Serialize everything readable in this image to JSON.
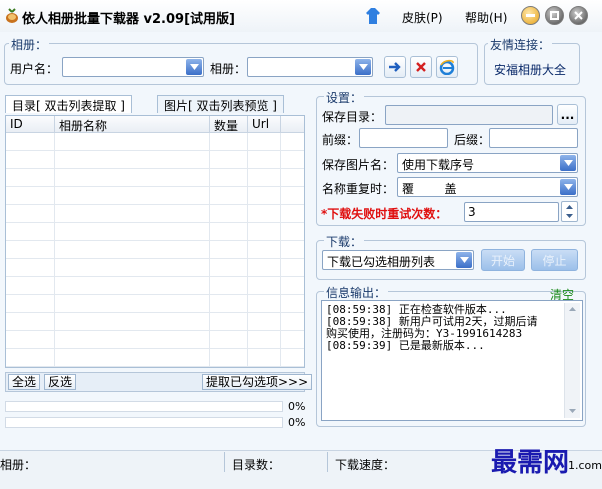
{
  "window": {
    "title": "依人相册批量下载器 v2.09[试用版]",
    "skin_label": "皮肤(P)",
    "help_label": "帮助(H)"
  },
  "album_group": {
    "legend": "相册：",
    "username_label": "用户名：",
    "username_value": "",
    "album_label": "相册：",
    "album_value": ""
  },
  "friend_links": {
    "legend": "友情连接：",
    "link_text": "安福相册大全"
  },
  "tabs": [
    {
      "label": "目录[ 双击列表提取 ]",
      "active": true
    },
    {
      "label": "图片[ 双击列表预览 ]",
      "active": false
    }
  ],
  "table": {
    "columns": [
      "ID",
      "相册名称",
      "数量",
      "Url"
    ],
    "rows": []
  },
  "list_actions": {
    "select_all": "全选",
    "invert": "反选",
    "extract": "提取已勾选项>>>"
  },
  "progress": [
    {
      "value": 0,
      "label": "0%"
    },
    {
      "value": 0,
      "label": "0%"
    }
  ],
  "settings": {
    "legend": "设置：",
    "save_dir_label": "保存目录：",
    "save_dir_value": "",
    "browse_label": "...",
    "prefix_label": "前缀：",
    "prefix_value": "",
    "suffix_label": "后缀：",
    "suffix_value": "",
    "image_name_label": "保存图片名：",
    "image_name_value": "使用下载序号",
    "dup_label": "名称重复时：",
    "dup_value": "覆        盖",
    "retry_label": "*下载失败时重试次数：",
    "retry_value": "3"
  },
  "download": {
    "legend": "下载：",
    "mode_value": "下载已勾选相册列表",
    "start_label": "开始",
    "stop_label": "停止"
  },
  "output": {
    "legend": "信息输出：",
    "clear_label": "清空",
    "lines": [
      "[08:59:38] 正在检查软件版本...",
      "[08:59:38] 新用户可试用2天，过期后请",
      "购买使用，注册码为：Y3-1991614283",
      "[08:59:39] 已是最新版本..."
    ]
  },
  "statusbar": {
    "album_label": "相册：",
    "dir_count_label": "目录数：",
    "speed_label": "下载速度：",
    "watermark": "最需网",
    "corner_text": "1.com"
  },
  "colors": {
    "accent": "#3b6fc8",
    "required_red": "#e01010",
    "watermark": "#1a1ab0"
  }
}
